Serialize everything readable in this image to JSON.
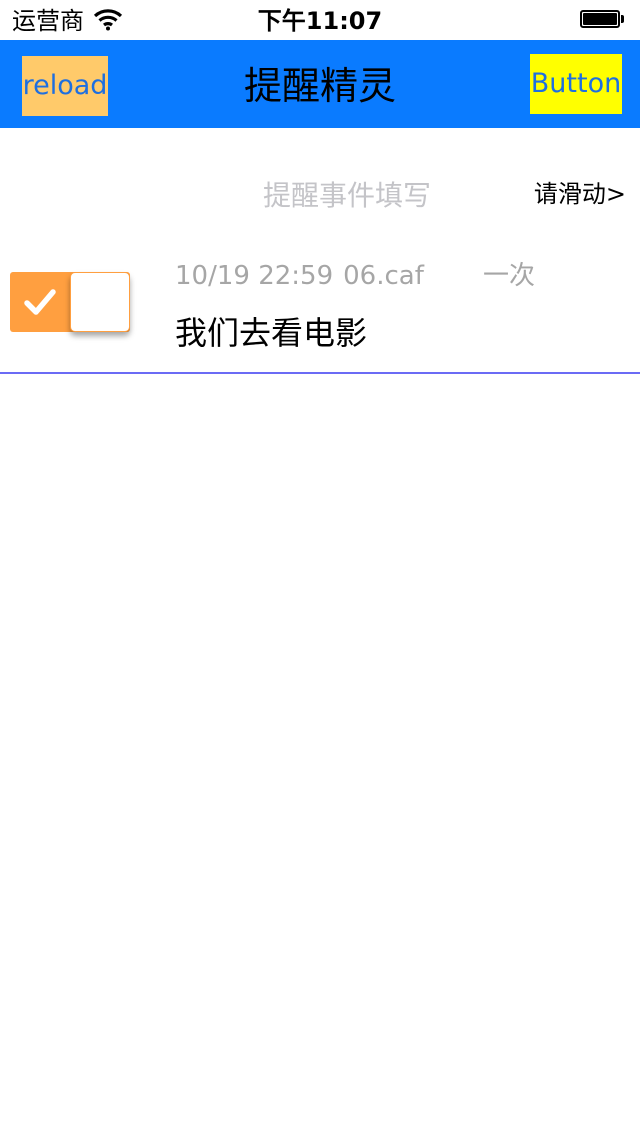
{
  "status_bar": {
    "carrier": "运营商",
    "time": "下午11:07",
    "icons": [
      "wifi-icon",
      "battery-icon"
    ]
  },
  "nav": {
    "reload_label": "reload",
    "title": "提醒精灵",
    "right_button_label": "Button"
  },
  "input_row": {
    "placeholder": "提醒事件填写",
    "value": "",
    "swipe_hint": "请滑动>"
  },
  "reminders": [
    {
      "enabled": true,
      "datetime": "10/19 22:59",
      "sound_file": "06.caf",
      "repeat": "一次",
      "text": "我们去看电影"
    }
  ],
  "colors": {
    "nav_background": "#0a7bff",
    "reload_background": "#ffca6a",
    "right_button_background": "#ffff00",
    "button_text": "#1e6fe0",
    "toggle_on": "#ff9f40",
    "row_separator": "#6b6bf5",
    "secondary_text": "#a6a6a6",
    "placeholder_text": "#c4c4c8"
  }
}
